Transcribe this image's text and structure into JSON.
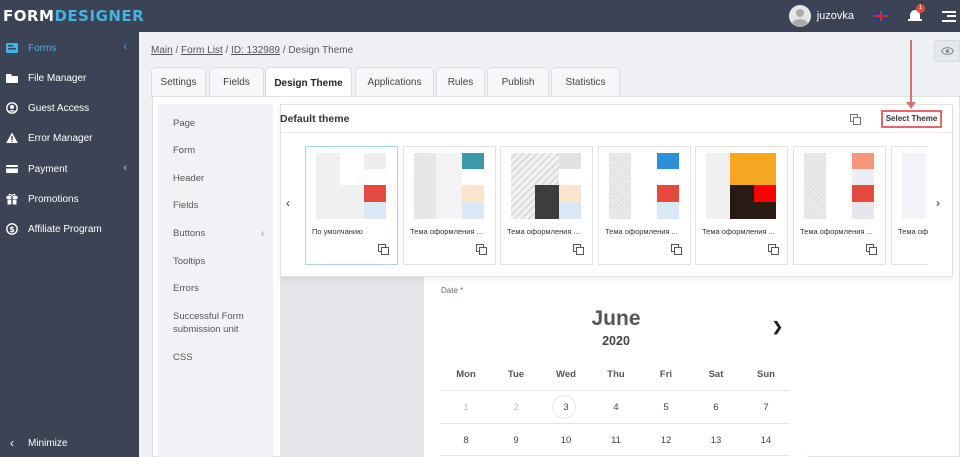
{
  "brand": {
    "part1": "FORM",
    "part2": "DESIGNER"
  },
  "user": {
    "name": "juzovka",
    "notifications": "1"
  },
  "sidebar": {
    "items": [
      {
        "label": "Forms"
      },
      {
        "label": "File Manager"
      },
      {
        "label": "Guest Access"
      },
      {
        "label": "Error Manager"
      },
      {
        "label": "Payment"
      },
      {
        "label": "Promotions"
      },
      {
        "label": "Affiliate Program"
      }
    ],
    "minimize": "Minimize"
  },
  "breadcrumb": {
    "main": "Main",
    "form_list": "Form List",
    "form_id": "ID: 132989",
    "current": "Design Theme",
    "sep": " / "
  },
  "tabs": [
    "Settings",
    "Fields",
    "Design Theme",
    "Applications",
    "Rules",
    "Publish",
    "Statistics"
  ],
  "submenu": [
    "Page",
    "Form",
    "Header",
    "Fields",
    "Buttons",
    "Tooltips",
    "Errors",
    "Successful Form submission unit",
    "CSS"
  ],
  "theme": {
    "title": "Default theme",
    "select_button": "Select Theme",
    "cards": [
      {
        "label": "По умолчанию"
      },
      {
        "label": "Тема оформления ..."
      },
      {
        "label": "Тема оформления ..."
      },
      {
        "label": "Тема оформления ..."
      },
      {
        "label": "Тема оформления ..."
      },
      {
        "label": "Тема оформления ..."
      },
      {
        "label": "Тема оф"
      }
    ]
  },
  "calendar": {
    "field_label": "Date",
    "required_mark": "*",
    "month": "June",
    "year": "2020",
    "weekdays": [
      "Mon",
      "Tue",
      "Wed",
      "Thu",
      "Fri",
      "Sat",
      "Sun"
    ],
    "week1": [
      "1",
      "2",
      "3",
      "4",
      "5",
      "6",
      "7"
    ],
    "week2": [
      "8",
      "9",
      "10",
      "11",
      "12",
      "13",
      "14"
    ]
  },
  "colors": {
    "sidebar_bg": "#3c4354",
    "accent": "#3fb5e5",
    "highlight": "#e26b5d"
  }
}
